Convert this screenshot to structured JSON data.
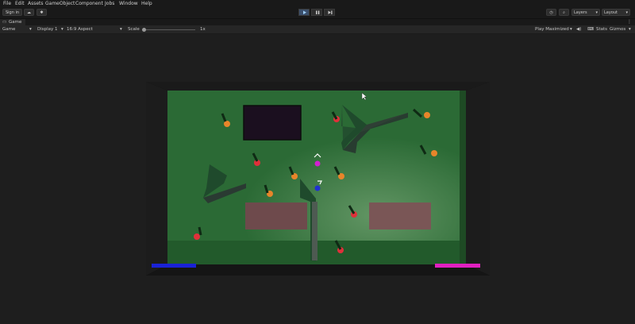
{
  "menu": [
    "File",
    "Edit",
    "Assets",
    "GameObject",
    "Component",
    "Jobs",
    "Window",
    "Help"
  ],
  "toolbar": {
    "sign_in": "Sign in",
    "layers": "Layers",
    "layout": "Layout"
  },
  "tab": {
    "label": "Game"
  },
  "game_bar": {
    "mode": "Game",
    "display": "Display 1",
    "aspect": "16:9 Aspect",
    "scale_label": "Scale",
    "scale_value": "1x",
    "play_mode": "Play Maximized",
    "stats": "Stats",
    "gizmos": "Gizmos"
  },
  "colors": {
    "floor": "#2b6a35",
    "wall": "#141414",
    "player_bar": "#1a22d6",
    "enemy_bar": "#e020c0",
    "red": "#e0303a",
    "orange": "#e8852a"
  }
}
